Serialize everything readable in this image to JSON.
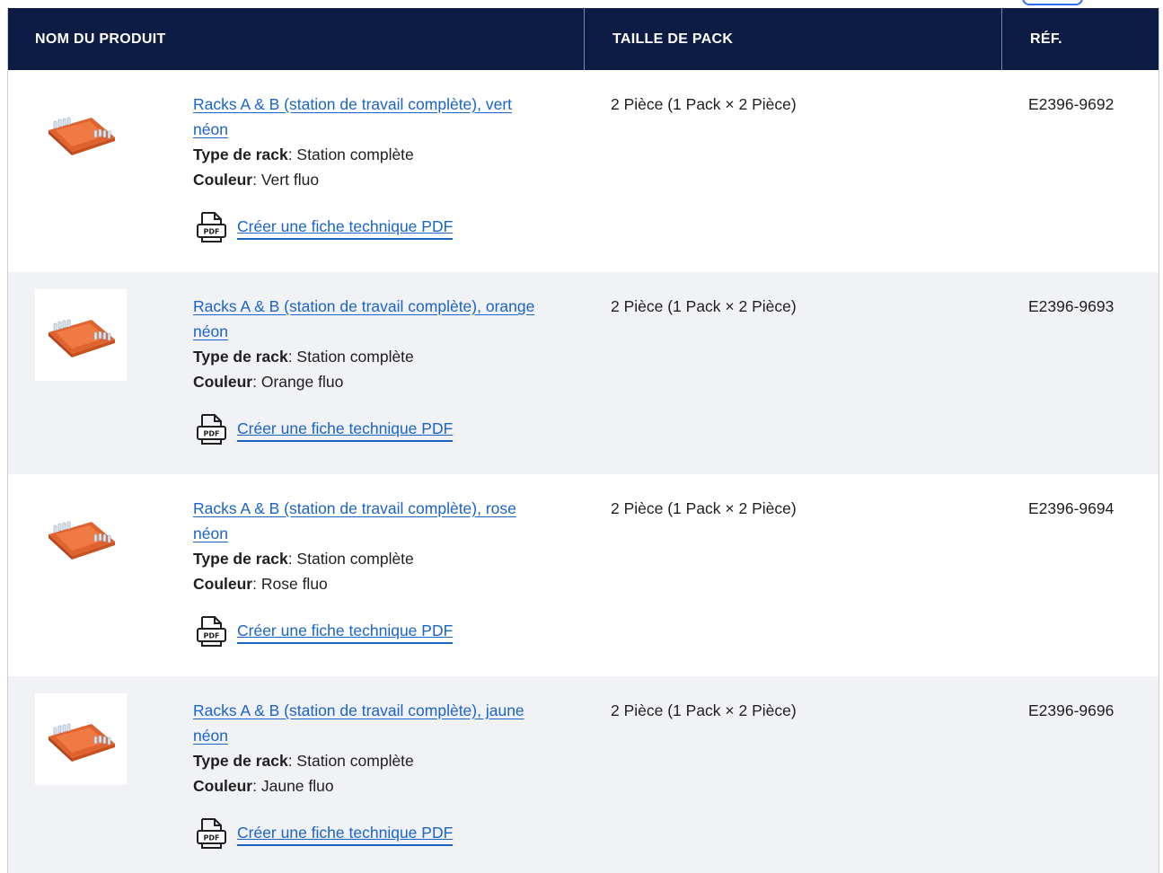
{
  "table": {
    "headers": {
      "name": "NOM DU PRODUIT",
      "pack": "TAILLE DE PACK",
      "ref": "RÉF."
    },
    "rows": [
      {
        "product_link": "Racks A & B (station de travail complète), vert néon",
        "rack_label": "Type de rack",
        "rack_value": ": Station complète",
        "color_label": "Couleur",
        "color_value": ": Vert fluo",
        "pdf_link": "Créer une fiche technique PDF",
        "pack_size": "2 Pièce (1 Pack × 2 Pièce)",
        "ref": "E2396-9692"
      },
      {
        "product_link": "Racks A & B (station de travail complète), orange néon",
        "rack_label": "Type de rack",
        "rack_value": ": Station complète",
        "color_label": "Couleur",
        "color_value": ": Orange fluo",
        "pdf_link": "Créer une fiche technique PDF",
        "pack_size": "2 Pièce (1 Pack × 2 Pièce)",
        "ref": "E2396-9693"
      },
      {
        "product_link": "Racks A & B (station de travail complète), rose néon",
        "rack_label": "Type de rack",
        "rack_value": ": Station complète",
        "color_label": "Couleur",
        "color_value": ": Rose fluo",
        "pdf_link": "Créer une fiche technique PDF",
        "pack_size": "2 Pièce (1 Pack × 2 Pièce)",
        "ref": "E2396-9694"
      },
      {
        "product_link": "Racks A & B (station de travail complète), jaune néon",
        "rack_label": "Type de rack",
        "rack_value": ": Station complète",
        "color_label": "Couleur",
        "color_value": ": Jaune fluo",
        "pdf_link": "Créer une fiche technique PDF",
        "pack_size": "2 Pièce (1 Pack × 2 Pièce)",
        "ref": "E2396-9696"
      }
    ]
  },
  "icons": {
    "product_image": "product-rack-image",
    "pdf": "pdf-icon"
  },
  "colors": {
    "header_bg": "#0d1c45",
    "link": "#1a63c9",
    "alt_row_bg": "#f1f2f5",
    "rack_color": "#e0622f"
  }
}
